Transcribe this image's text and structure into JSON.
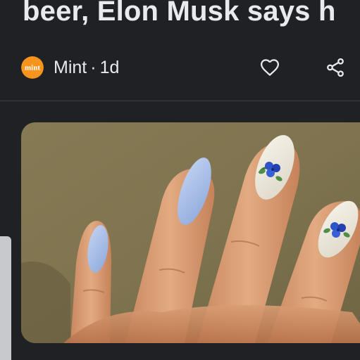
{
  "article": {
    "headline": "beer, Elon Musk says h"
  },
  "source": {
    "name": "Mint",
    "separator": "·",
    "age": "1d",
    "logo_text": "mint",
    "logo_color": "#f7941d"
  },
  "actions": {
    "like_icon": "heart-outline-icon",
    "share_icon": "share-icon"
  },
  "image": {
    "description_icon": "nail-art-photo"
  },
  "colors": {
    "background": "#202124",
    "text": "#e8eaed",
    "divider": "#3c4043"
  }
}
